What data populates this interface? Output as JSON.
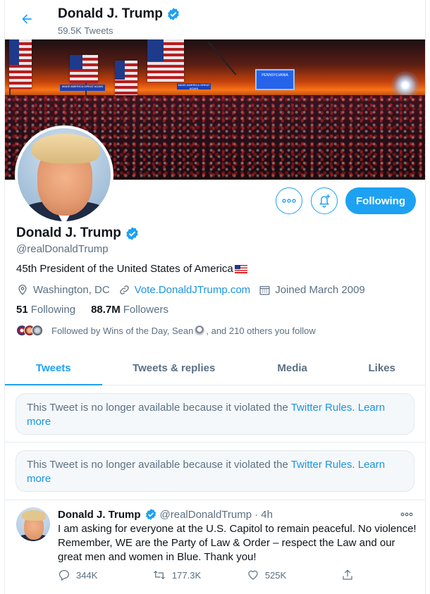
{
  "header": {
    "name": "Donald J. Trump",
    "tweet_count": "59.5K Tweets"
  },
  "banner": {
    "stage_sign": "PENNSYLVANIA",
    "banner_text_1": "MAKE AMERICA GREAT AGAIN",
    "banner_text_2": "MAKE AMERICA GREAT AGAIN"
  },
  "actions": {
    "following_label": "Following"
  },
  "profile": {
    "name": "Donald J. Trump",
    "handle": "@realDonaldTrump",
    "bio": "45th President of the United States of America",
    "location": "Washington, DC",
    "website": "Vote.DonaldJTrump.com",
    "joined": "Joined March 2009",
    "following_count": "51",
    "following_label": "Following",
    "followers_count": "88.7M",
    "followers_label": "Followers",
    "followed_by_prefix": "Followed by Wins of the Day, Sean",
    "followed_by_suffix": ", and 210 others you follow"
  },
  "tabs": [
    {
      "label": "Tweets",
      "active": true
    },
    {
      "label": "Tweets & replies",
      "active": false
    },
    {
      "label": "Media",
      "active": false
    },
    {
      "label": "Likes",
      "active": false
    }
  ],
  "unavailable_notices": [
    {
      "text": "This Tweet is no longer available because it violated the ",
      "rules_link": "Twitter Rules",
      "period": ". ",
      "learn_more": "Learn more"
    },
    {
      "text": "This Tweet is no longer available because it violated the ",
      "rules_link": "Twitter Rules",
      "period": ". ",
      "learn_more": "Learn more"
    }
  ],
  "tweet": {
    "name": "Donald J. Trump",
    "handle": "@realDonaldTrump",
    "time": "· 4h",
    "body": "I am asking for everyone at the U.S. Capitol to remain peaceful. No violence! Remember, WE are the Party of Law & Order – respect the Law and our great men and women in Blue. Thank you!",
    "replies": "344K",
    "retweets": "177.3K",
    "likes": "525K"
  },
  "colors": {
    "accent": "#1da1f2",
    "text_secondary": "#5b7083",
    "link": "#1b95e0"
  }
}
